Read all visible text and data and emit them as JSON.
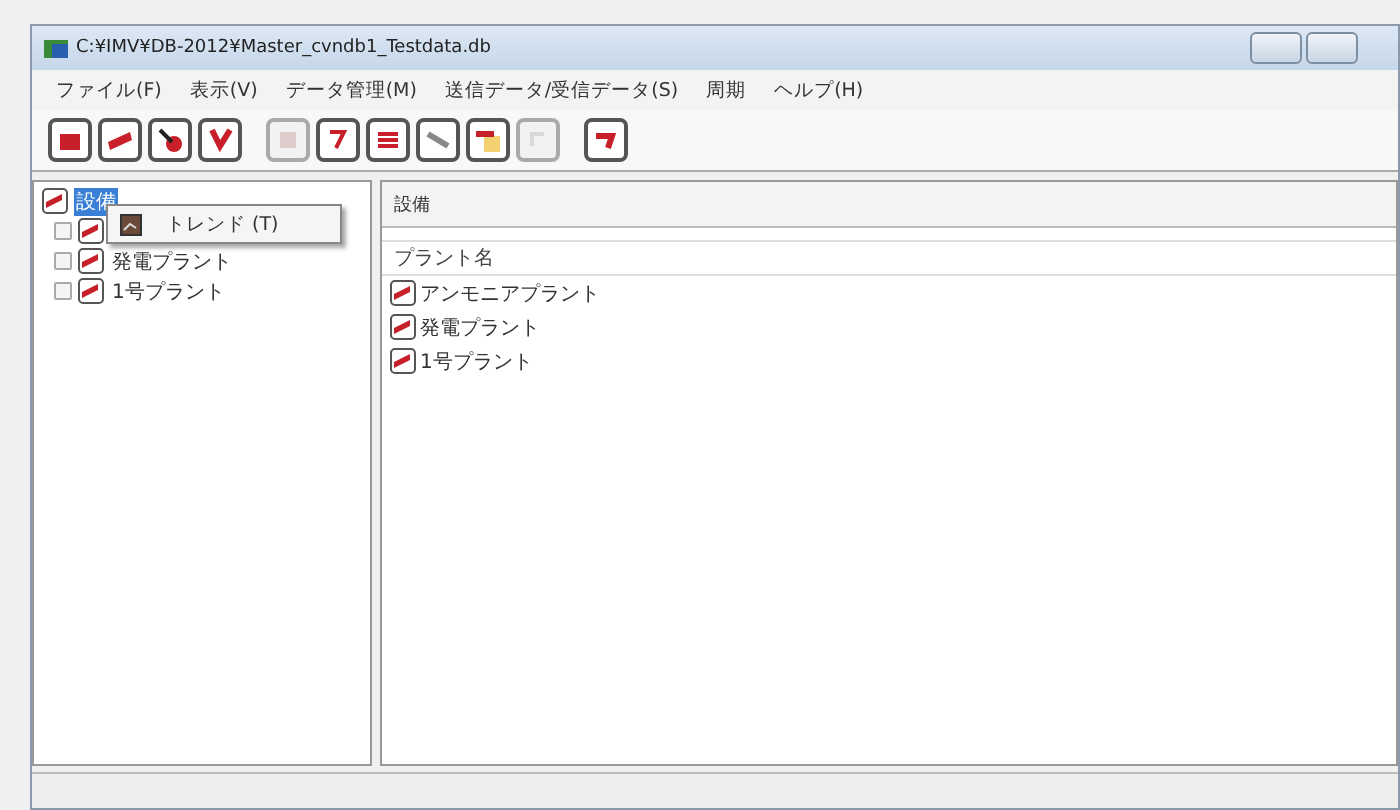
{
  "window": {
    "title": "C:¥IMV¥DB-2012¥Master_cvndb1_Testdata.db"
  },
  "menu_bar": [
    "ファイル(F)",
    "表示(V)",
    "データ管理(M)",
    "送信データ/受信データ(S)",
    "周期",
    "ヘルプ(H)"
  ],
  "toolbar": [
    {
      "disabled": false
    },
    {
      "disabled": false
    },
    {
      "disabled": false
    },
    {
      "disabled": false
    },
    {
      "disabled": true
    },
    {
      "disabled": false
    },
    {
      "disabled": false
    },
    {
      "disabled": false
    },
    {
      "disabled": false
    },
    {
      "disabled": true
    },
    {
      "disabled": false
    }
  ],
  "tree": {
    "label": "設備",
    "selected": true,
    "children": [
      {
        "selected": false
      },
      {
        "label": "発電プラント",
        "selected": false
      },
      {
        "label": "1号プラント",
        "selected": false
      }
    ]
  },
  "context_menu": {
    "items": [
      {
        "label": "トレンド (T)"
      }
    ]
  },
  "panel": {
    "title": "設備",
    "column": "プラント名",
    "rows": [
      "アンモニアプラント",
      "発電プラント",
      "1号プラント"
    ]
  }
}
